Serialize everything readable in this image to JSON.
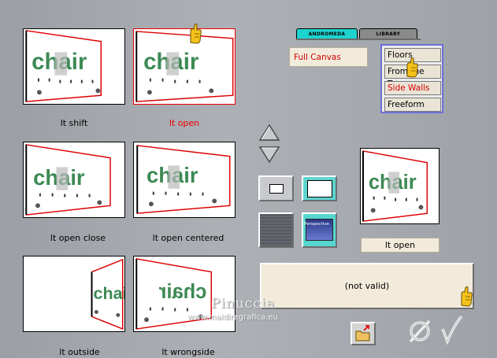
{
  "thumbnails": [
    {
      "caption": "lt shift",
      "selected": false
    },
    {
      "caption": "lt open",
      "selected": true
    },
    {
      "caption": "lt open close",
      "selected": false
    },
    {
      "caption": "lt open centered",
      "selected": false
    },
    {
      "caption": "lt outside",
      "selected": false
    },
    {
      "caption": "lt wrongside",
      "selected": false
    }
  ],
  "thumb_word": "chair",
  "tabs": {
    "active": "ANDROMEDA",
    "inactive": "LIBRARY"
  },
  "mode_field": "Full Canvas",
  "menu": [
    "Floors",
    "From the Top",
    "Side Walls",
    "Freeform"
  ],
  "preview_caption": "lt open",
  "status_text": "(not valid)",
  "perspective_label": "Perspective",
  "watermark": {
    "name": "Pinuccia",
    "url": "www.maidiregrafica.eu"
  },
  "colors": {
    "selected": "#e00000",
    "accent": "#1ed3cf",
    "menu_border": "#6b6fd6",
    "chair_green": "#3d8a55"
  }
}
